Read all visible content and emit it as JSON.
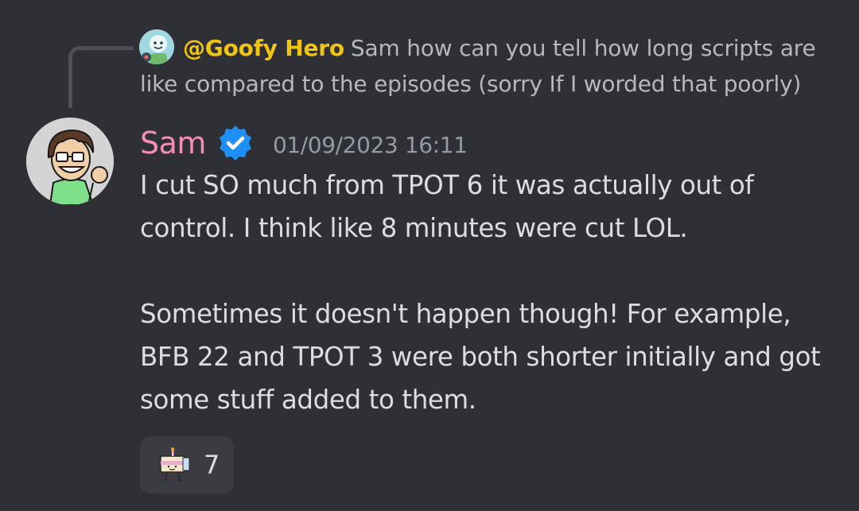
{
  "reply": {
    "author": "@Goofy Hero",
    "text": "Sam how can you tell how long scripts are like compared to the episodes (sorry If I worded that poorly)"
  },
  "message": {
    "author": "Sam",
    "verified_icon": "verified-badge-icon",
    "timestamp": "01/09/2023 16:11",
    "paragraphs": [
      "I cut SO much from TPOT 6 it was actually out of control. I think like 8 minutes were cut LOL.",
      "Sometimes it doesn't happen though! For example, BFB 22 and TPOT 3 were both shorter initially and got some stuff added to them."
    ]
  },
  "reaction": {
    "emoji": "cake-character-emoji",
    "count": "7"
  },
  "colors": {
    "background": "#2f3035",
    "reply_author": "#f1c40f",
    "username": "#f48fb1",
    "verified": "#1e8ff5",
    "timestamp": "#949ba4",
    "text": "#dbdee1"
  }
}
